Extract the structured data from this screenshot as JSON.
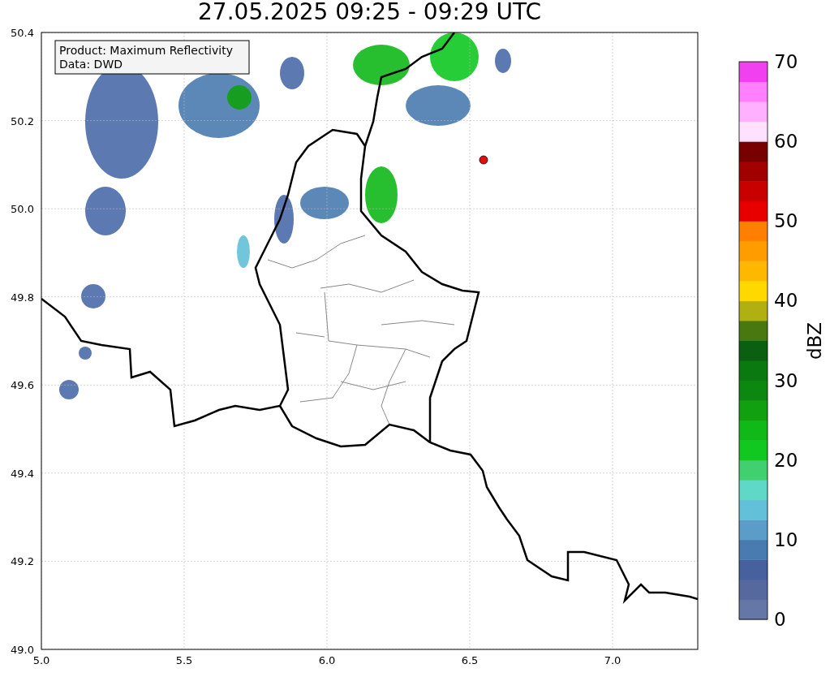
{
  "title": "27.05.2025 09:25 - 09:29 UTC",
  "legend": [
    "Product: Maximum Reflectivity",
    "Data: DWD"
  ],
  "x_ticks": [
    "5.0",
    "5.5",
    "6.0",
    "6.5",
    "7.0"
  ],
  "y_ticks": [
    "50.4",
    "50.2",
    "50.0",
    "49.8",
    "49.6",
    "49.4",
    "49.2",
    "49.0"
  ],
  "colorbar": {
    "label": "dBZ",
    "ticks": [
      "70",
      "60",
      "50",
      "40",
      "30",
      "20",
      "10",
      "0"
    ],
    "segments": [
      {
        "color": "#6577a7"
      },
      {
        "color": "#55699f"
      },
      {
        "color": "#46619d"
      },
      {
        "color": "#4a7bb0"
      },
      {
        "color": "#5b9cc8"
      },
      {
        "color": "#62c0d8"
      },
      {
        "color": "#60d8c8"
      },
      {
        "color": "#40d070"
      },
      {
        "color": "#10c820"
      },
      {
        "color": "#10b818"
      },
      {
        "color": "#10a010"
      },
      {
        "color": "#0c8810"
      },
      {
        "color": "#0a7a10"
      },
      {
        "color": "#0a6010"
      },
      {
        "color": "#4a7810"
      },
      {
        "color": "#b0b010"
      },
      {
        "color": "#ffd800"
      },
      {
        "color": "#ffb800"
      },
      {
        "color": "#ff9c00"
      },
      {
        "color": "#ff8000"
      },
      {
        "color": "#e80000"
      },
      {
        "color": "#c80000"
      },
      {
        "color": "#a00000"
      },
      {
        "color": "#780000"
      },
      {
        "color": "#ffe0ff"
      },
      {
        "color": "#ffb0ff"
      },
      {
        "color": "#ff80ff"
      },
      {
        "color": "#f040f0"
      }
    ]
  }
}
